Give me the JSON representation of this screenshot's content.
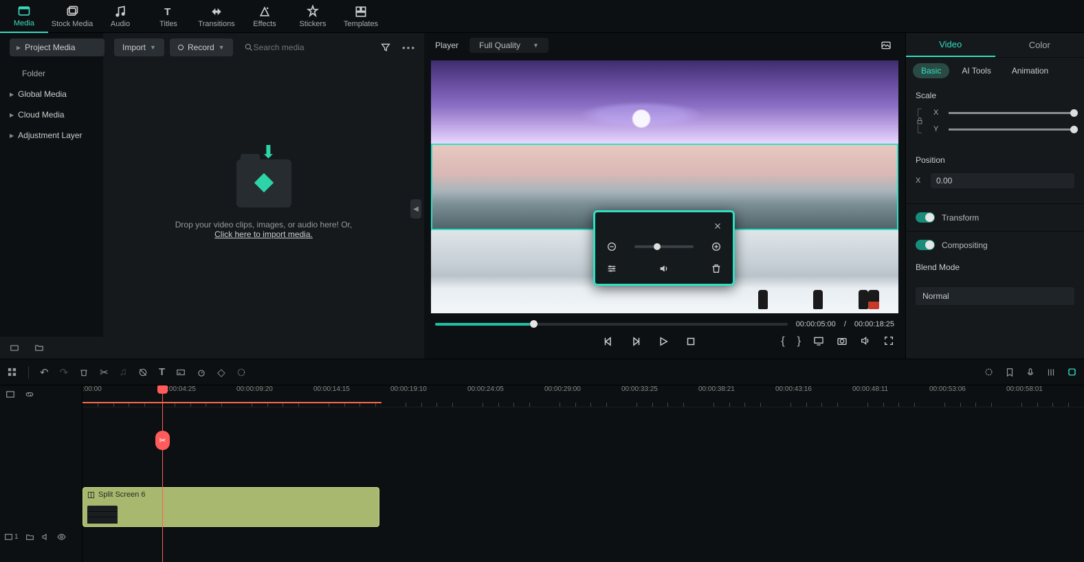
{
  "top_tabs": {
    "media": "Media",
    "stock": "Stock Media",
    "audio": "Audio",
    "titles": "Titles",
    "transitions": "Transitions",
    "effects": "Effects",
    "stickers": "Stickers",
    "templates": "Templates"
  },
  "left": {
    "import": "Import",
    "record": "Record",
    "search_ph": "Search media",
    "project_media": "Project Media",
    "folder": "Folder",
    "global": "Global Media",
    "cloud": "Cloud Media",
    "adjustment": "Adjustment Layer",
    "drop1": "Drop your video clips, images, or audio here! Or,",
    "drop2": "Click here to import media."
  },
  "player": {
    "label": "Player",
    "quality": "Full Quality",
    "time_cur": "00:00:05:00",
    "time_sep": "/",
    "time_total": "00:00:18:25"
  },
  "popup_icons": {
    "close": "close-icon",
    "zoom_out": "zoom-out-icon",
    "zoom_in": "zoom-in-icon",
    "sliders": "sliders-icon",
    "speaker": "speaker-icon",
    "trash": "trash-icon"
  },
  "right": {
    "video": "Video",
    "color": "Color",
    "basic": "Basic",
    "ai_tools": "AI Tools",
    "animation": "Animation",
    "scale": "Scale",
    "x": "X",
    "y": "Y",
    "position": "Position",
    "pos_x_val": "0.00",
    "transform": "Transform",
    "compositing": "Compositing",
    "blend_mode": "Blend Mode",
    "blend_val": "Normal"
  },
  "timeline": {
    "ticks": [
      ":00:00",
      "00:00:04:25",
      "00:00:09:20",
      "00:00:14:15",
      "00:00:19:10",
      "00:00:24:05",
      "00:00:29:00",
      "00:00:33:25",
      "00:00:38:21",
      "00:00:43:16",
      "00:00:48:11",
      "00:00:53:06",
      "00:00:58:01"
    ],
    "clip_name": "Split Screen 6",
    "track_badge": "1"
  }
}
